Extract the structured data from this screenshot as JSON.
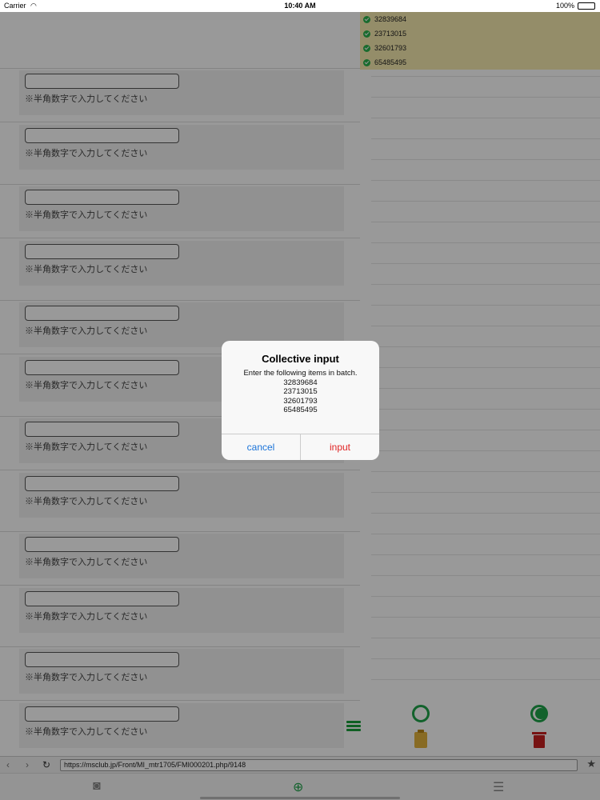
{
  "status_bar": {
    "carrier": "Carrier",
    "wifi_icon": "wifi-icon",
    "time": "10:40 AM",
    "battery_percent": "100%"
  },
  "form": {
    "rows": [
      {
        "hint": "※半角数字で入力してください",
        "value": ""
      },
      {
        "hint": "※半角数字で入力してください",
        "value": ""
      },
      {
        "hint": "※半角数字で入力してください",
        "value": ""
      },
      {
        "hint": "※半角数字で入力してください",
        "value": ""
      },
      {
        "hint": "※半角数字で入力してください",
        "value": ""
      },
      {
        "hint": "※半角数字で入力してください",
        "value": ""
      },
      {
        "hint": "※半角数字で入力してください",
        "value": ""
      },
      {
        "hint": "※半角数字で入力してください",
        "value": ""
      },
      {
        "hint": "※半角数字で入力してください",
        "value": ""
      },
      {
        "hint": "※半角数字で入力してください",
        "value": ""
      },
      {
        "hint": "※半角数字で入力してください",
        "value": ""
      },
      {
        "hint": "※半角数字で入力してください",
        "value": ""
      }
    ]
  },
  "right_panel": {
    "checked_items": [
      "32839684",
      "23713015",
      "32601793",
      "65485495"
    ],
    "actions": {
      "circle_icon": "circle-icon",
      "multi_check_icon": "multi-check-icon",
      "list_icon": "list-icon",
      "clipboard_icon": "clipboard-check-icon",
      "trash_icon": "trash-icon"
    },
    "colors": {
      "check": "#2bb24c",
      "highlight": "#f7ecb0",
      "trash": "#c62020"
    }
  },
  "browser": {
    "back": "‹",
    "forward": "›",
    "reload": "↻",
    "url": "https://msclub.jp/Front/MI_mtr1705/FMI000201.php/9148",
    "star": "★"
  },
  "toolbar": {
    "camera_icon": "camera-icon",
    "globe_icon": "globe-icon",
    "sliders_icon": "sliders-icon"
  },
  "dialog": {
    "title": "Collective input",
    "message": "Enter the following items in batch.",
    "items": [
      "32839684",
      "23713015",
      "32601793",
      "65485495"
    ],
    "cancel_label": "cancel",
    "confirm_label": "input",
    "colors": {
      "cancel": "#1a73d9",
      "confirm": "#e02424"
    }
  }
}
